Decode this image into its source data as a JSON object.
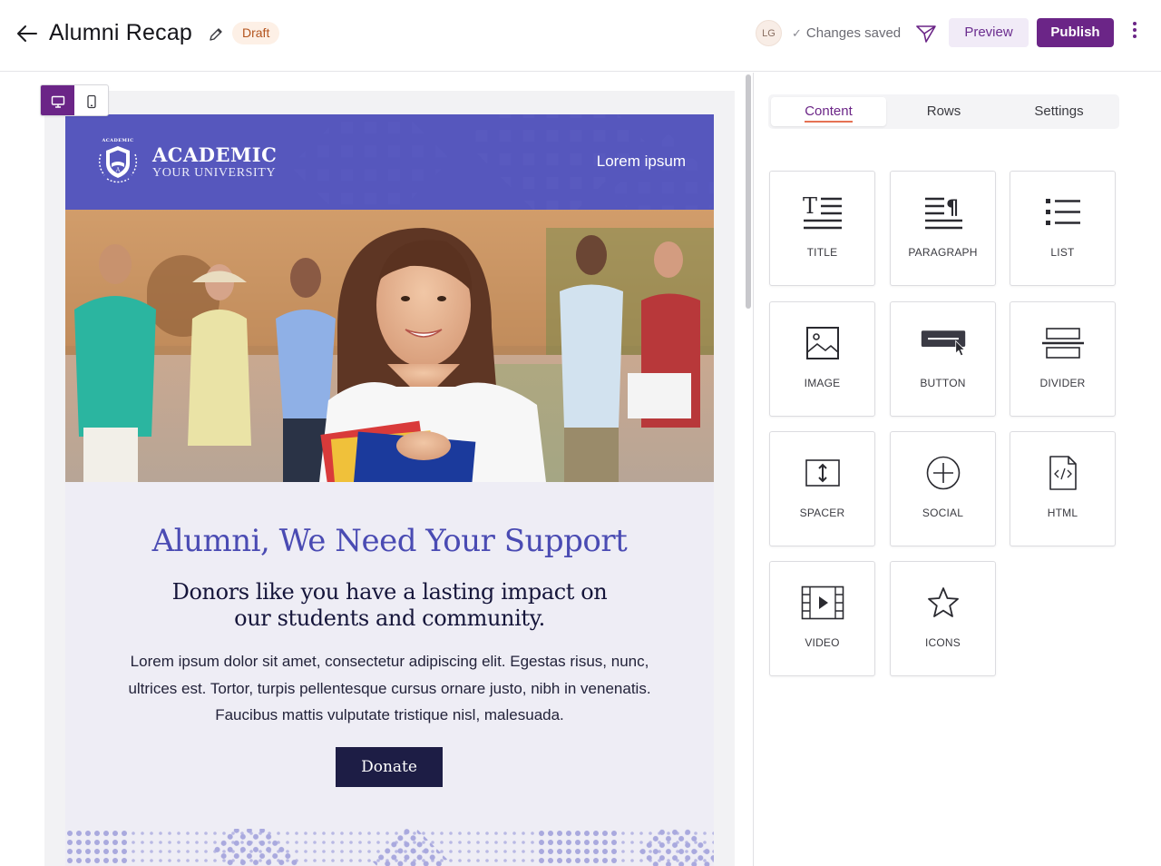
{
  "header": {
    "title": "Alumni Recap",
    "status_badge": "Draft",
    "avatar_initials": "LG",
    "save_status": "Changes saved",
    "preview_label": "Preview",
    "publish_label": "Publish"
  },
  "view_modes": [
    "desktop",
    "mobile"
  ],
  "email": {
    "brand_name": "ACADEMIC",
    "brand_subtitle": "YOUR UNIVERSITY",
    "crest_text": "ACADEMIC",
    "header_link": "Lorem ipsum",
    "headline": "Alumni, We Need Your Support",
    "subheadline": "Donors like you have a lasting impact on our students and community.",
    "body": "Lorem ipsum dolor sit amet, consectetur adipiscing elit. Egestas risus, nunc, ultrices est. Tortor, turpis pellentesque cursus ornare justo, nibh in venenatis. Faucibus mattis vulputate tristique nisl, malesuada.",
    "cta_label": "Donate",
    "colors": {
      "header_bg": "#5657bd",
      "headline": "#4a4bb3",
      "cta_bg": "#1d1d45",
      "body_bg": "#eeedf5"
    }
  },
  "panel": {
    "tabs": [
      {
        "label": "Content",
        "active": true
      },
      {
        "label": "Rows",
        "active": false
      },
      {
        "label": "Settings",
        "active": false
      }
    ],
    "blocks": [
      {
        "label": "TITLE",
        "icon": "title-icon"
      },
      {
        "label": "PARAGRAPH",
        "icon": "paragraph-icon"
      },
      {
        "label": "LIST",
        "icon": "list-icon"
      },
      {
        "label": "IMAGE",
        "icon": "image-icon"
      },
      {
        "label": "BUTTON",
        "icon": "button-icon"
      },
      {
        "label": "DIVIDER",
        "icon": "divider-icon"
      },
      {
        "label": "SPACER",
        "icon": "spacer-icon"
      },
      {
        "label": "SOCIAL",
        "icon": "social-icon"
      },
      {
        "label": "HTML",
        "icon": "html-icon"
      },
      {
        "label": "VIDEO",
        "icon": "video-icon"
      },
      {
        "label": "ICONS",
        "icon": "star-icon"
      }
    ]
  },
  "accent_color": "#6b2587"
}
